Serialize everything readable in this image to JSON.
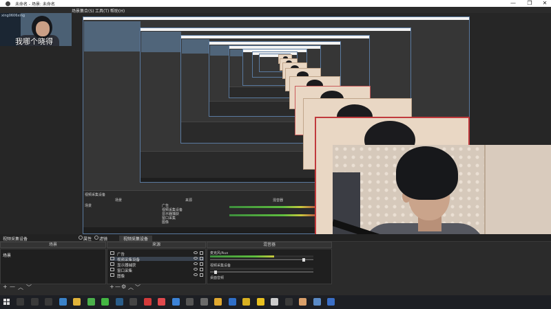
{
  "window": {
    "title": "未命名 - 场景: 未命名",
    "minimize_glyph": "—",
    "restore_glyph": "❐",
    "close_glyph": "✕"
  },
  "menu": [
    "场景集合(S)",
    "工具(T)",
    "帮助(H)"
  ],
  "preview": {
    "webcam_caption": "我哪个晓得",
    "webcam_small_text": "xing0606xing"
  },
  "dock": {
    "audio_source_header": "视频采集设备",
    "properties_label": "属性",
    "filters_label": "滤镜",
    "panels": {
      "scenes_header": "场景",
      "sources_header": "来源",
      "mixer_header": "混音器"
    },
    "scenes": [
      "场景"
    ],
    "sources": [
      {
        "icon": "image-icon",
        "label": "广告"
      },
      {
        "icon": "camera-icon",
        "label": "视频采集设备"
      },
      {
        "icon": "monitor-icon",
        "label": "显示器捕获"
      },
      {
        "icon": "screen-capture-icon",
        "label": "窗口采集"
      },
      {
        "icon": "image-icon",
        "label": "图像"
      }
    ],
    "mixer": [
      {
        "name": "麦克风/Aux",
        "level": 0.62,
        "volume": 0.92
      },
      {
        "name": "视频采集设备",
        "level": 0.0,
        "volume": 0.04
      },
      {
        "name": "桌面音频",
        "level": 0.0,
        "volume": 0.5
      }
    ],
    "toolbar_glyphs": {
      "add": "+",
      "remove": "—",
      "up": "︿",
      "down": "﹀",
      "settings": "⚙"
    }
  },
  "nested_dock": {
    "header": "视频采集设备",
    "scenes_header": "场景",
    "sources_header": "来源",
    "mixer_header": "混音器",
    "scene": "场景",
    "sources": [
      "广告",
      "视频采集设备",
      "显示器捕获",
      "窗口采集",
      "图像"
    ]
  },
  "taskbar": {
    "icons": [
      {
        "name": "search-icon",
        "color": "#3a3a3a"
      },
      {
        "name": "cortana-icon",
        "color": "#3a3a3a"
      },
      {
        "name": "taskview-icon",
        "color": "#3a3a3a"
      },
      {
        "name": "files-icon",
        "color": "#3a82c9"
      },
      {
        "name": "folder-icon",
        "color": "#e0b33a"
      },
      {
        "name": "browser-green-icon",
        "color": "#4bb04b"
      },
      {
        "name": "wechat-icon",
        "color": "#43b642"
      },
      {
        "name": "steam-icon",
        "color": "#2a5d8a"
      },
      {
        "name": "game-icon",
        "color": "#444444"
      },
      {
        "name": "red-app-icon",
        "color": "#d23a3a"
      },
      {
        "name": "weibo-icon",
        "color": "#e0494d"
      },
      {
        "name": "chrome-icon",
        "color": "#3c82d6"
      },
      {
        "name": "terminal-icon",
        "color": "#555555"
      },
      {
        "name": "photo-icon",
        "color": "#6a6a6a"
      },
      {
        "name": "shield-icon",
        "color": "#e0a830"
      },
      {
        "name": "music-icon",
        "color": "#2f6fc9"
      },
      {
        "name": "coin-icon",
        "color": "#d8b021"
      },
      {
        "name": "circle-app-icon",
        "color": "#e8c020"
      },
      {
        "name": "arrow-app-icon",
        "color": "#cccccc"
      },
      {
        "name": "obs-icon",
        "color": "#3a3a3a"
      },
      {
        "name": "cursor-app-icon",
        "color": "#d9a06a"
      },
      {
        "name": "gallery-icon",
        "color": "#5a8ac6"
      },
      {
        "name": "mail-icon",
        "color": "#3a6ec6"
      }
    ]
  }
}
